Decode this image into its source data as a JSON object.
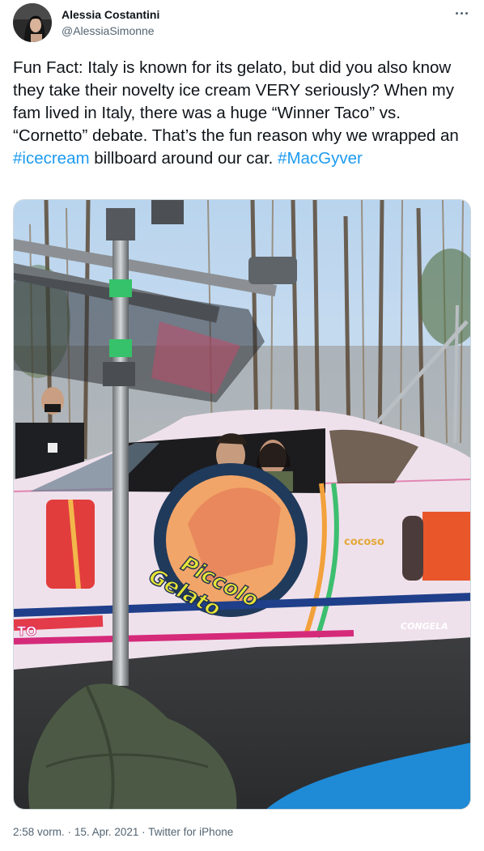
{
  "author": {
    "display_name": "Alessia Costantini",
    "handle": "@AlessiaSimonne"
  },
  "tweet": {
    "text_parts": [
      "Fun Fact: Italy is known for its gelato, but did you also know they take their novelty ice cream VERY seriously? When my fam lived in Italy, there was a huge “Winner Taco” vs. “Cornetto” debate. That’s the fun reason why we wrapped an ",
      "#icecream",
      " billboard around our car. ",
      "#MacGyver"
    ],
    "photo": {
      "logo_line1": "Piccolo",
      "logo_line2": "Gelato",
      "wrap_texts": [
        "cocoso",
        "TO",
        "CONGELA"
      ]
    },
    "timestamp": "2:58 vorm.",
    "separator": "·",
    "date": "15. Apr. 2021",
    "source": "Twitter for iPhone"
  },
  "colors": {
    "link": "#1d9bf0",
    "text": "#0f1419",
    "secondary": "#536471"
  },
  "icons": {
    "more": "more-horizontal-icon"
  }
}
